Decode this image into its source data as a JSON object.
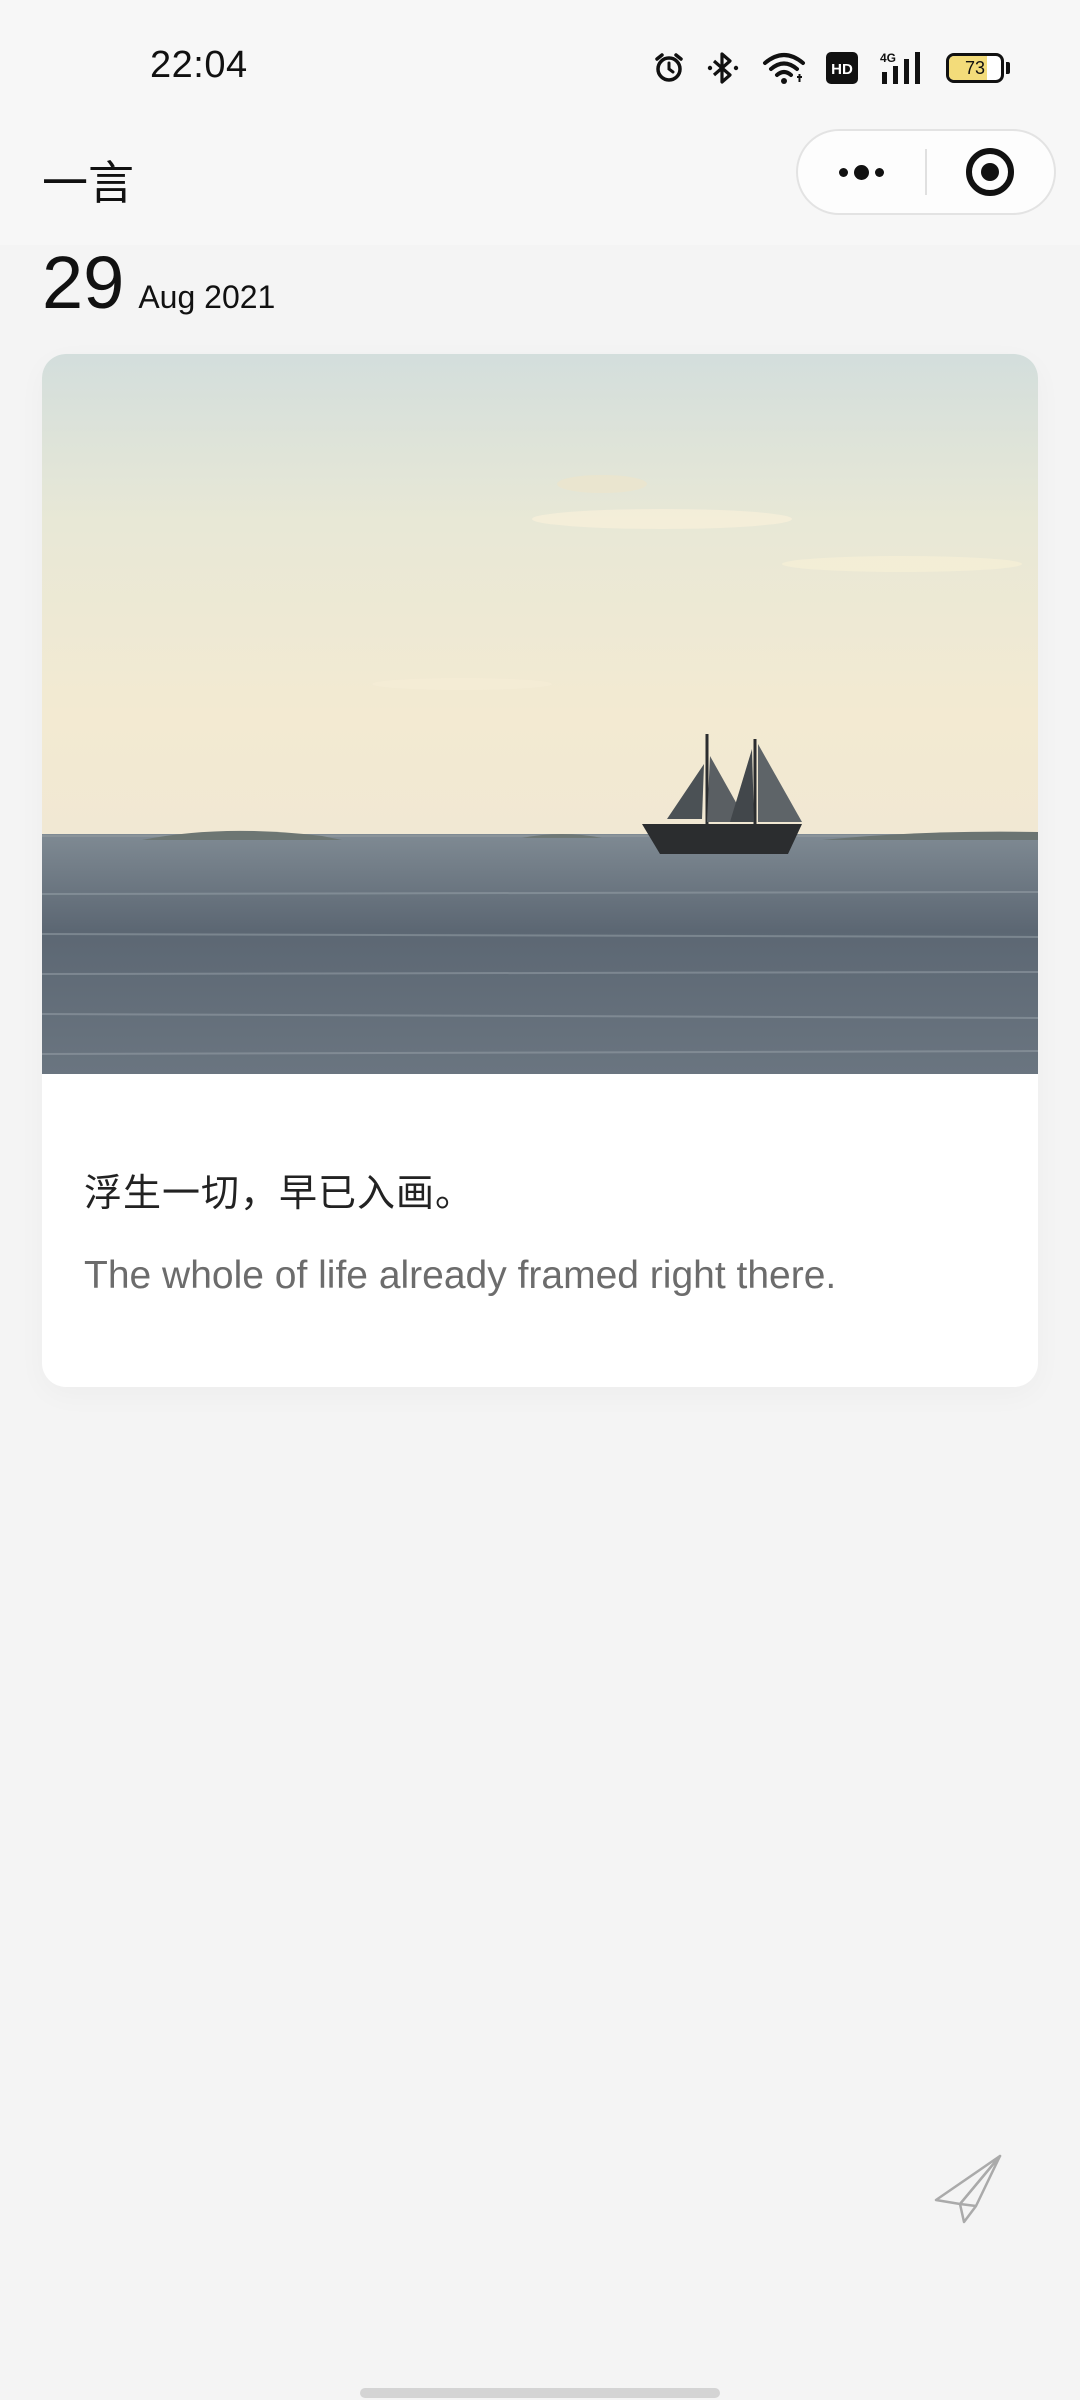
{
  "status_bar": {
    "time": "22:04",
    "icons": [
      "alarm-icon",
      "bluetooth-icon",
      "wifi-icon",
      "hd-icon",
      "signal-4g-icon",
      "battery-icon"
    ],
    "hd_label": "HD",
    "network_label": "4G",
    "battery_level": "73",
    "battery_fraction": 0.73
  },
  "nav": {
    "title": "一言",
    "capsule": {
      "more": "more-icon",
      "close": "target-icon"
    }
  },
  "date": {
    "day": "29",
    "month_year": "Aug 2021"
  },
  "card": {
    "image": "sailboat-at-sea-photo",
    "quote_cn": "浮生一切，早已入画。",
    "quote_en": "The whole of life already framed right there."
  },
  "actions": {
    "share": "paper-plane-icon"
  },
  "colors": {
    "background": "#f4f4f4",
    "card": "#ffffff",
    "text_primary": "#111111",
    "text_secondary": "#6c6c6c",
    "battery_fill": "#f3dc7a"
  }
}
